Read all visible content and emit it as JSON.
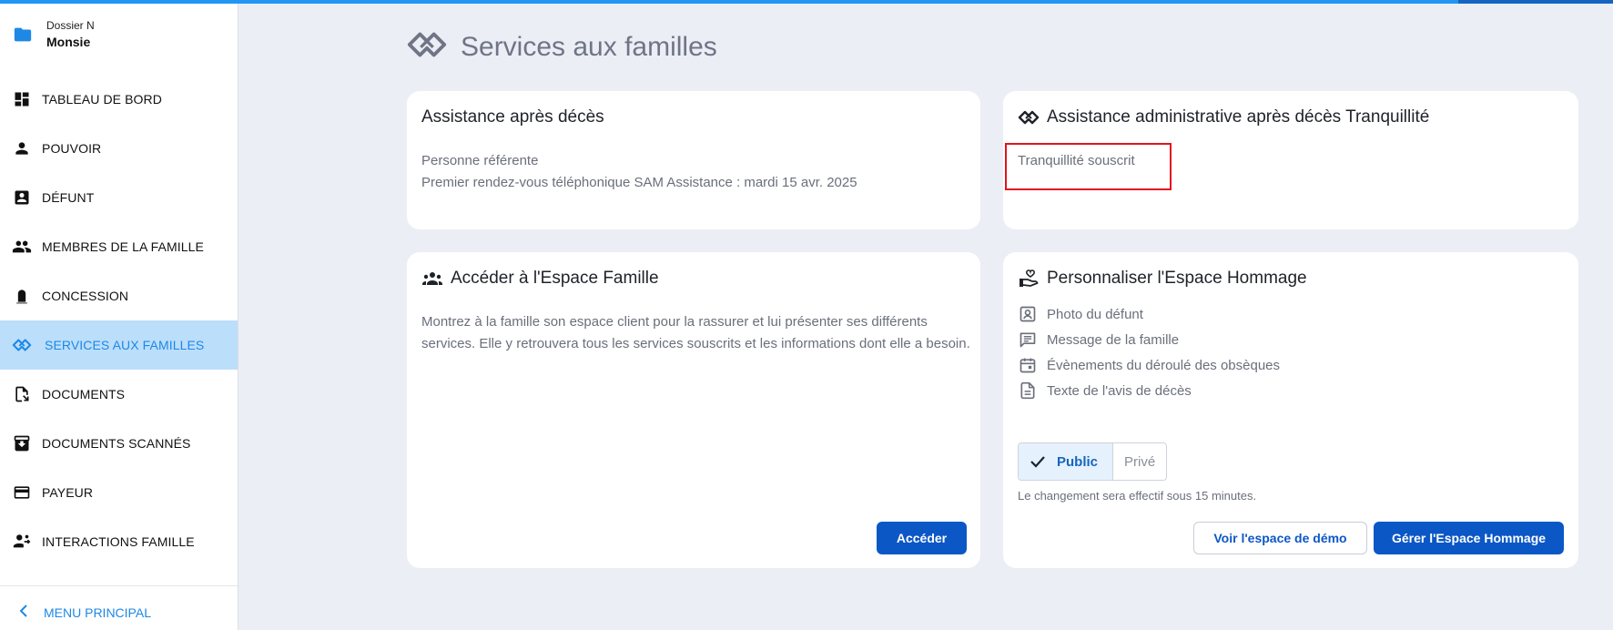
{
  "sidebar": {
    "dossier_label": "Dossier N",
    "dossier_name": "Monsie",
    "items": [
      {
        "label": "TABLEAU DE BORD",
        "icon": "dashboard-icon"
      },
      {
        "label": "POUVOIR",
        "icon": "person-icon"
      },
      {
        "label": "DÉFUNT",
        "icon": "contact-card-icon"
      },
      {
        "label": "MEMBRES DE LA FAMILLE",
        "icon": "people-icon"
      },
      {
        "label": "CONCESSION",
        "icon": "tombstone-icon"
      },
      {
        "label": "SERVICES AUX FAMILLES",
        "icon": "handshake-icon",
        "active": true
      },
      {
        "label": "DOCUMENTS",
        "icon": "document-icon"
      },
      {
        "label": "DOCUMENTS SCANNÉS",
        "icon": "archive-icon"
      },
      {
        "label": "PAYEUR",
        "icon": "credit-card-icon"
      },
      {
        "label": "INTERACTIONS FAMILLE",
        "icon": "interaction-icon"
      }
    ],
    "menu_principal": "MENU PRINCIPAL"
  },
  "page": {
    "title": "Services aux familles"
  },
  "card_assistance": {
    "title": "Assistance après décès",
    "line1": "Personne référente",
    "line2": "Premier rendez-vous téléphonique SAM Assistance : mardi 15 avr. 2025"
  },
  "card_tranquillite": {
    "title": "Assistance administrative après décès Tranquillité",
    "status": "Tranquillité souscrit"
  },
  "card_espace_famille": {
    "title": "Accéder à l'Espace Famille",
    "description": "Montrez à la famille son espace client pour la rassurer et lui présenter ses différents services. Elle y retrouvera tous les services souscrits et les informations dont elle a besoin.",
    "button": "Accéder"
  },
  "card_hommage": {
    "title": "Personnaliser l'Espace Hommage",
    "features": [
      "Photo du défunt",
      "Message de la famille",
      "Évènements du déroulé des obsèques",
      "Texte de l'avis de décès"
    ],
    "visibility_options": [
      "Public",
      "Privé"
    ],
    "visibility_selected": "Public",
    "note": "Le changement sera effectif sous 15 minutes.",
    "demo_button": "Voir l'espace de démo",
    "manage_button": "Gérer l'Espace Hommage"
  },
  "colors": {
    "accent": "#2196f3",
    "primary_button": "#0b57c6",
    "active_nav_bg": "#bbdefb",
    "highlight": "#e0141e"
  }
}
